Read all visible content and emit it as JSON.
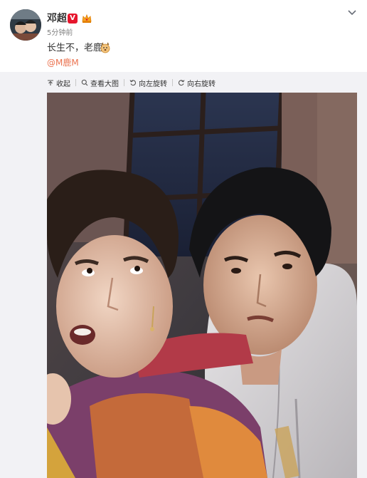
{
  "post": {
    "username": "邓超",
    "verified_mark": "V",
    "timestamp": "5分钟前",
    "text": "长生不，老鹿",
    "mention": "@M鹿M"
  },
  "toolbar": {
    "collapse_label": "收起",
    "view_large_label": "查看大图",
    "rotate_left_label": "向左旋转",
    "rotate_right_label": "向右旋转"
  },
  "icons": {
    "avatar": "avatar-photo",
    "verified": "verified-badge",
    "crown": "crown-icon",
    "emoji": "deer-emoji",
    "chevron": "chevron-down-icon",
    "collapse": "collapse-up-icon",
    "view_large": "magnifier-icon",
    "rotate_left": "rotate-left-icon",
    "rotate_right": "rotate-right-icon"
  },
  "colors": {
    "accent_link": "#eb7350",
    "verified_red": "#e6162d",
    "toolbar_bg": "#f2f2f5"
  }
}
